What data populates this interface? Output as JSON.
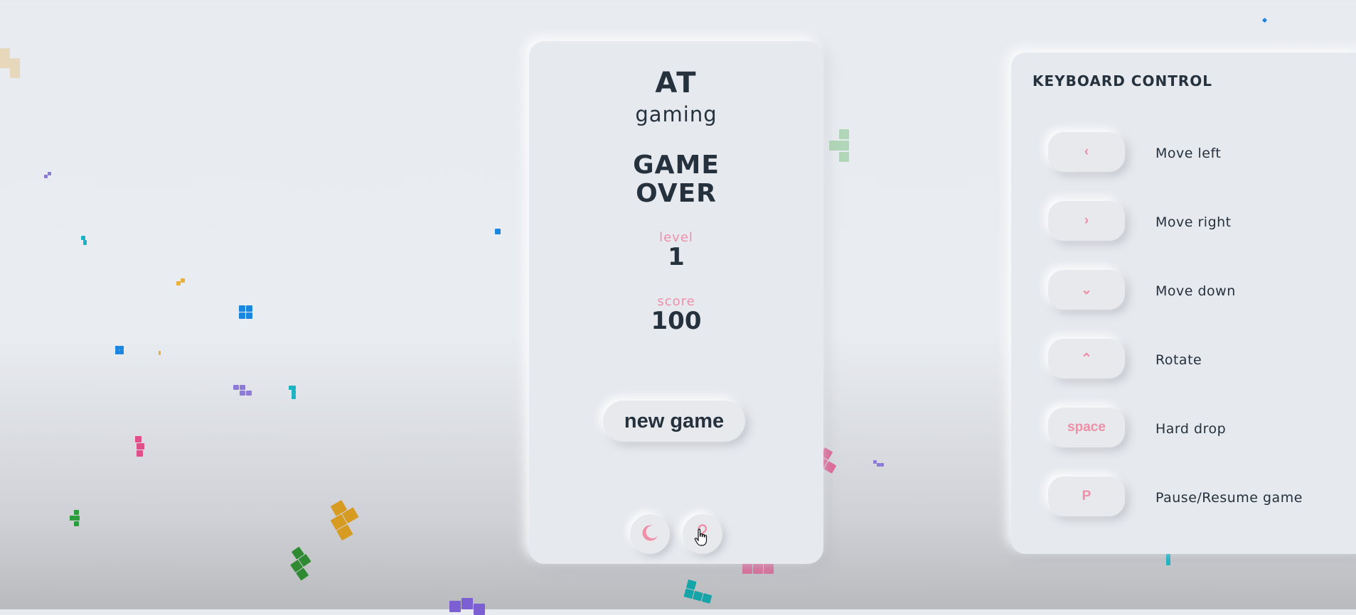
{
  "game": {
    "brand_title": "AT",
    "brand_subtitle": "gaming",
    "status_line1": "GAME",
    "status_line2": "OVER",
    "level_label": "level",
    "level_value": "1",
    "score_label": "score",
    "score_value": "100",
    "new_game_label": "new game",
    "theme_toggle_icon": "moon-icon",
    "help_icon": "question-icon"
  },
  "controls": {
    "title": "KEYBOARD CONTROL",
    "items": [
      {
        "key": "‹",
        "action": "Move left",
        "icon": "chevron-left-icon"
      },
      {
        "key": "›",
        "action": "Move right",
        "icon": "chevron-right-icon"
      },
      {
        "key": "⌄",
        "action": "Move down",
        "icon": "chevron-down-icon"
      },
      {
        "key": "⌃",
        "action": "Rotate",
        "icon": "chevron-up-icon"
      },
      {
        "key": "space",
        "action": "Hard drop"
      },
      {
        "key": "P",
        "action": "Pause/Resume game"
      }
    ]
  },
  "colors": {
    "accent_pink": "#ef8fa8",
    "text_dark": "#25313d",
    "card_bg": "#e6e9ee"
  }
}
